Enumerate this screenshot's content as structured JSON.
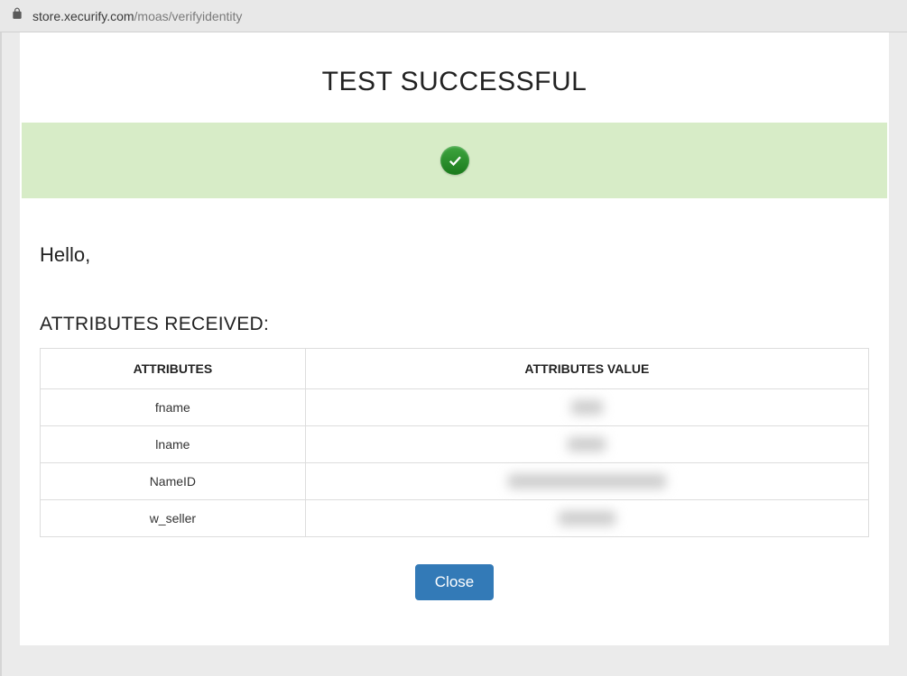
{
  "browser": {
    "url_host": "store.xecurify.com",
    "url_path": "/moas/verifyidentity"
  },
  "header": {
    "title": "TEST SUCCESSFUL"
  },
  "greeting": "Hello,",
  "section_heading": "ATTRIBUTES RECEIVED:",
  "table": {
    "header_attr": "ATTRIBUTES",
    "header_val": "ATTRIBUTES VALUE",
    "rows": [
      {
        "name": "fname",
        "value": "xxxxx"
      },
      {
        "name": "lname",
        "value": "xxxxxx"
      },
      {
        "name": "NameID",
        "value": "xxxxxxxxxxxxxxxxxxxxxxxxx"
      },
      {
        "name": "w_seller",
        "value": "xxxxxxxxx"
      }
    ]
  },
  "buttons": {
    "close": "Close"
  }
}
